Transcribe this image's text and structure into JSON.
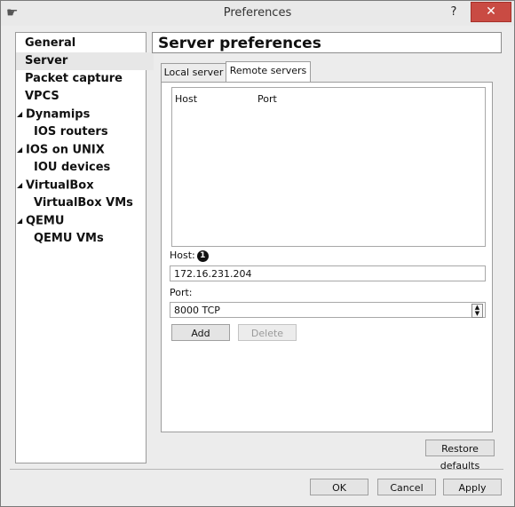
{
  "window": {
    "title": "Preferences",
    "help_label": "?",
    "close_label": "✕"
  },
  "sidebar": {
    "items": [
      {
        "label": "General",
        "arrow": ""
      },
      {
        "label": "Server",
        "arrow": "",
        "selected": true
      },
      {
        "label": "Packet capture",
        "arrow": ""
      },
      {
        "label": "VPCS",
        "arrow": ""
      },
      {
        "label": "Dynamips",
        "arrow": "◢"
      },
      {
        "label": "IOS routers",
        "arrow": ""
      },
      {
        "label": "IOS on UNIX",
        "arrow": "◢"
      },
      {
        "label": "IOU devices",
        "arrow": ""
      },
      {
        "label": "VirtualBox",
        "arrow": "◢"
      },
      {
        "label": "VirtualBox VMs",
        "arrow": ""
      },
      {
        "label": "QEMU",
        "arrow": "◢"
      },
      {
        "label": "QEMU VMs",
        "arrow": ""
      }
    ]
  },
  "panel": {
    "title": "Server preferences",
    "tabs": [
      {
        "label": "Local server"
      },
      {
        "label": "Remote servers",
        "active": true
      }
    ],
    "table": {
      "headers": [
        "Host",
        "Port"
      ]
    },
    "host_label": "Host:",
    "host_badge": "1",
    "host_value": "172.16.231.204",
    "port_label": "Port:",
    "port_value": "8000 TCP",
    "add_label": "Add",
    "delete_label": "Delete",
    "restore_label": "Restore defaults"
  },
  "footer": {
    "ok_label": "OK",
    "cancel_label": "Cancel",
    "apply_label": "Apply"
  }
}
